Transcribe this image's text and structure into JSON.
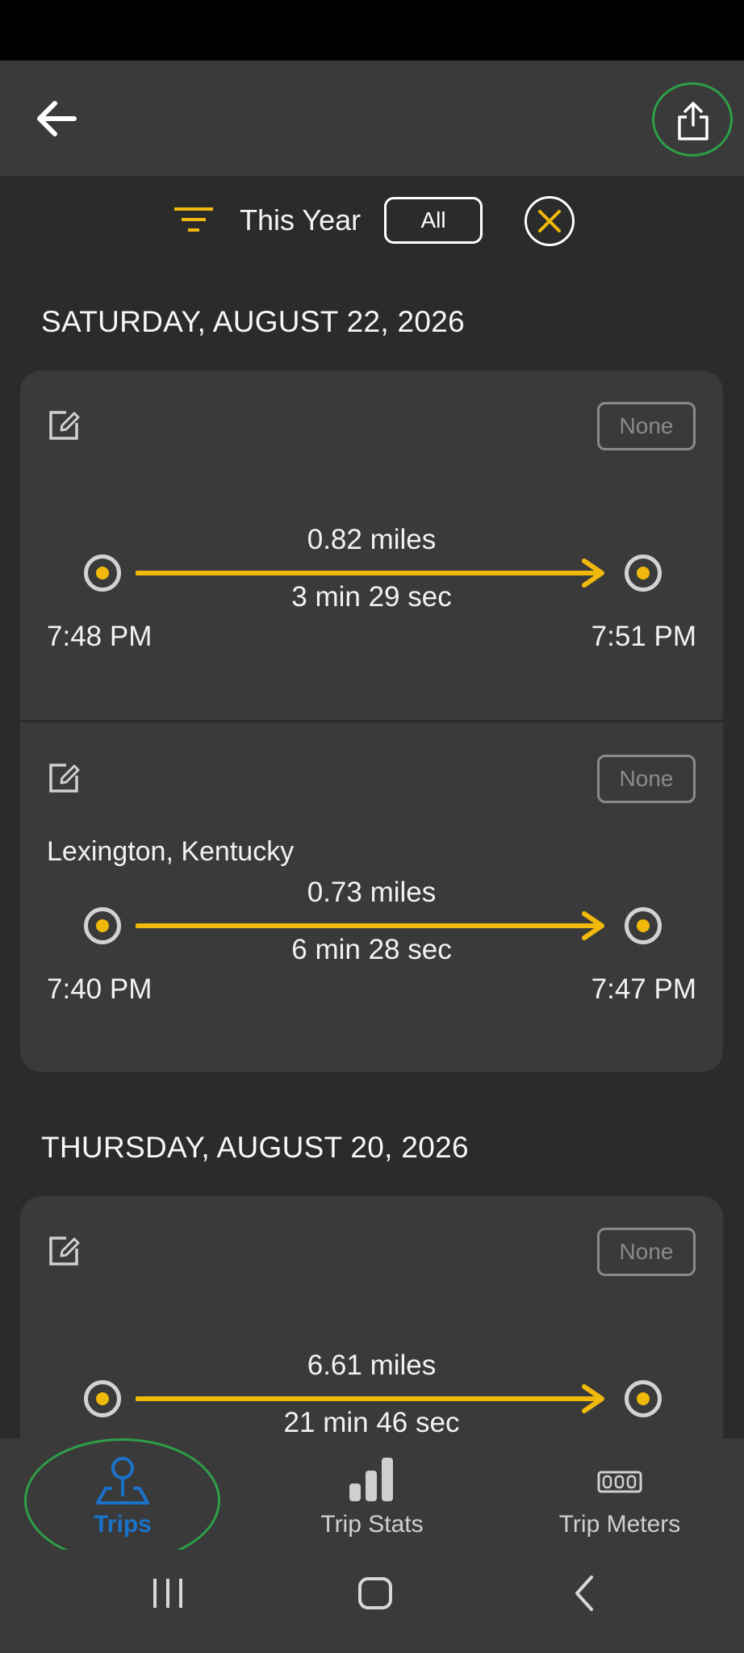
{
  "header": {
    "back_icon": "arrow-left-icon",
    "share_icon": "share-upload-icon"
  },
  "filter": {
    "icon": "filter-lines-icon",
    "period_label": "This Year",
    "scope_button": "All",
    "clear_icon": "close-circle-icon"
  },
  "groups": [
    {
      "date": "SATURDAY, AUGUST 22, 2026",
      "trips": [
        {
          "badge": "None",
          "location": "",
          "distance": "0.82 miles",
          "duration": "3 min 29 sec",
          "start_time": "7:48 PM",
          "end_time": "7:51 PM"
        },
        {
          "badge": "None",
          "location": "Lexington, Kentucky",
          "distance": "0.73 miles",
          "duration": "6 min 28 sec",
          "start_time": "7:40 PM",
          "end_time": "7:47 PM"
        }
      ]
    },
    {
      "date": "THURSDAY, AUGUST 20, 2026",
      "trips": [
        {
          "badge": "None",
          "location": "",
          "distance": "6.61 miles",
          "duration": "21 min 46 sec",
          "start_time": "",
          "end_time": ""
        }
      ]
    }
  ],
  "bottom_nav": {
    "items": [
      {
        "label": "Trips",
        "icon": "map-pin-icon",
        "active": true
      },
      {
        "label": "Trip Stats",
        "icon": "bar-chart-icon",
        "active": false
      },
      {
        "label": "Trip Meters",
        "icon": "odometer-icon",
        "active": false
      }
    ]
  },
  "colors": {
    "accent": "#f0b90b",
    "active_nav": "#1a73c9",
    "highlight_ring": "#2e9f47",
    "background": "#2b2b2b",
    "card": "#3a3a3a"
  }
}
